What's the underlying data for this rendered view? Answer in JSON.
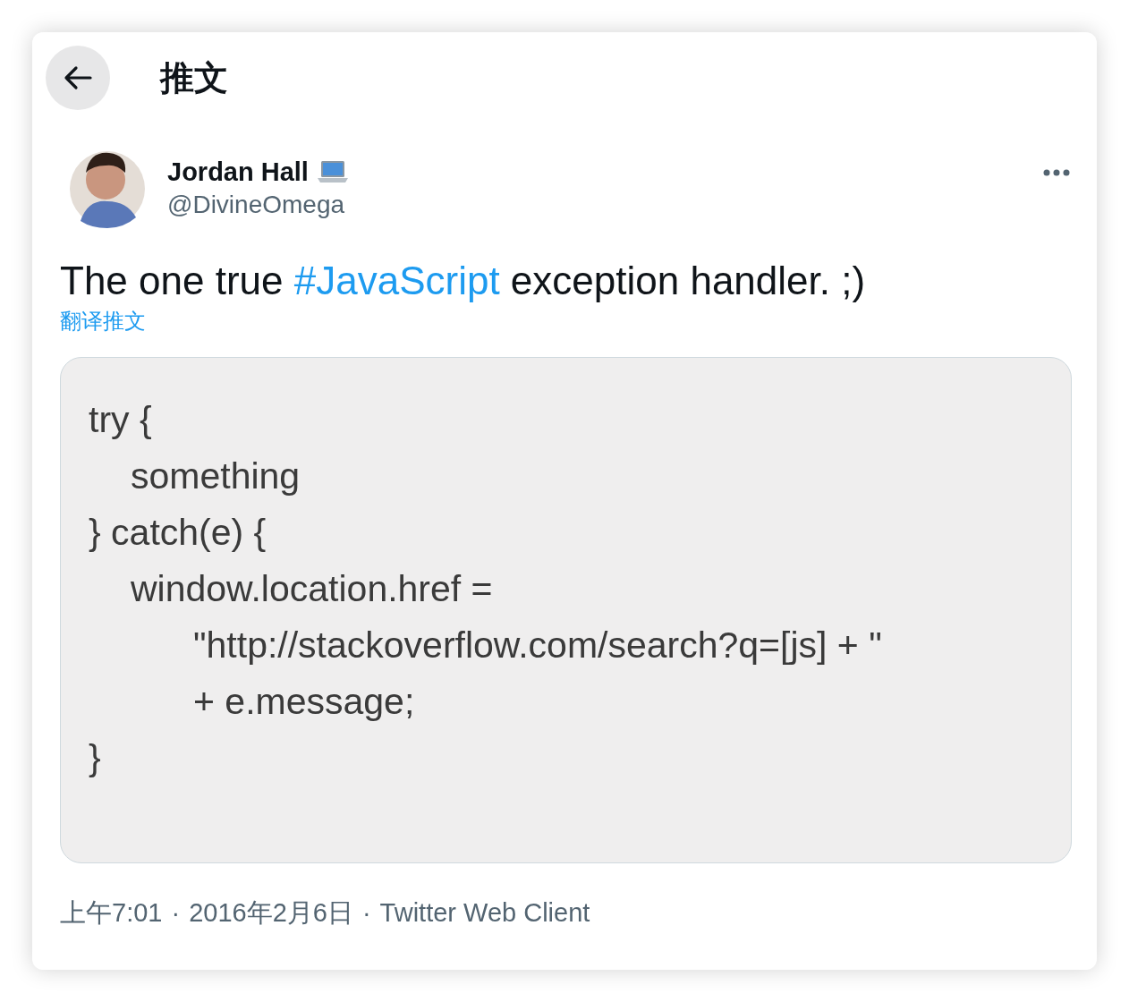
{
  "header": {
    "title": "推文"
  },
  "author": {
    "name": "Jordan Hall",
    "handle": "@DivineOmega"
  },
  "tweet": {
    "text_before": "The one true ",
    "hashtag": "#JavaScript",
    "text_after": " exception handler. ;)",
    "translate_link": "翻译推文"
  },
  "code_image": {
    "lines": [
      {
        "text": "try {",
        "kind": "outer"
      },
      {
        "text": "something",
        "kind": "inner"
      },
      {
        "text": "} catch(e) {",
        "kind": "outer"
      },
      {
        "text": "window.location.href =",
        "kind": "inner"
      },
      {
        "text": "\"http://stackoverflow.com/search?q=[js] + \"",
        "kind": "deep"
      },
      {
        "text": "+ e.message;",
        "kind": "deep"
      },
      {
        "text": "}",
        "kind": "outer"
      }
    ]
  },
  "footer": {
    "time": "上午7:01",
    "date": "2016年2月6日",
    "source": "Twitter Web Client",
    "separator": "·"
  }
}
